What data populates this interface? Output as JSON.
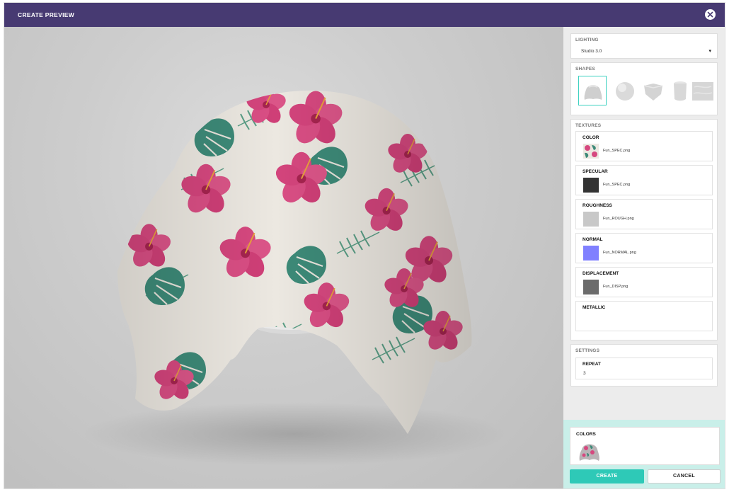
{
  "window": {
    "title": "CREATE PREVIEW",
    "close_icon": "close-icon"
  },
  "lighting": {
    "label": "LIGHTING",
    "selected": "Studio 3.0"
  },
  "shapes": {
    "label": "SHAPES",
    "items": [
      {
        "name": "drape",
        "active": true
      },
      {
        "name": "sphere",
        "active": false
      },
      {
        "name": "cushion",
        "active": false
      },
      {
        "name": "cylinder",
        "active": false
      },
      {
        "name": "plane",
        "active": false
      }
    ]
  },
  "textures": {
    "label": "TEXTURES",
    "items": [
      {
        "label": "COLOR",
        "file": "Fun_SPEC.png",
        "swatch": "floral"
      },
      {
        "label": "SPECULAR",
        "file": "Fun_SPEC.png",
        "swatch": "#333333"
      },
      {
        "label": "ROUGHNESS",
        "file": "Fun_ROUGH.png",
        "swatch": "#c8c8c8"
      },
      {
        "label": "NORMAL",
        "file": "Fun_NORMAL.png",
        "swatch": "#8080ff"
      },
      {
        "label": "DISPLACEMENT",
        "file": "Fun_DISP.png",
        "swatch": "#6b6b6b"
      },
      {
        "label": "METALLIC",
        "file": "",
        "swatch": ""
      }
    ]
  },
  "settings": {
    "label": "SETTINGS",
    "repeat_label": "REPEAT",
    "repeat_value": "3"
  },
  "colors": {
    "label": "COLORS"
  },
  "actions": {
    "create": "CREATE",
    "cancel": "CANCEL"
  },
  "theme": {
    "header": "#473a72",
    "accent": "#2ec9b7",
    "normal_map": "#8080ff",
    "pink": "#d6487f",
    "leaf": "#3d8a78"
  }
}
